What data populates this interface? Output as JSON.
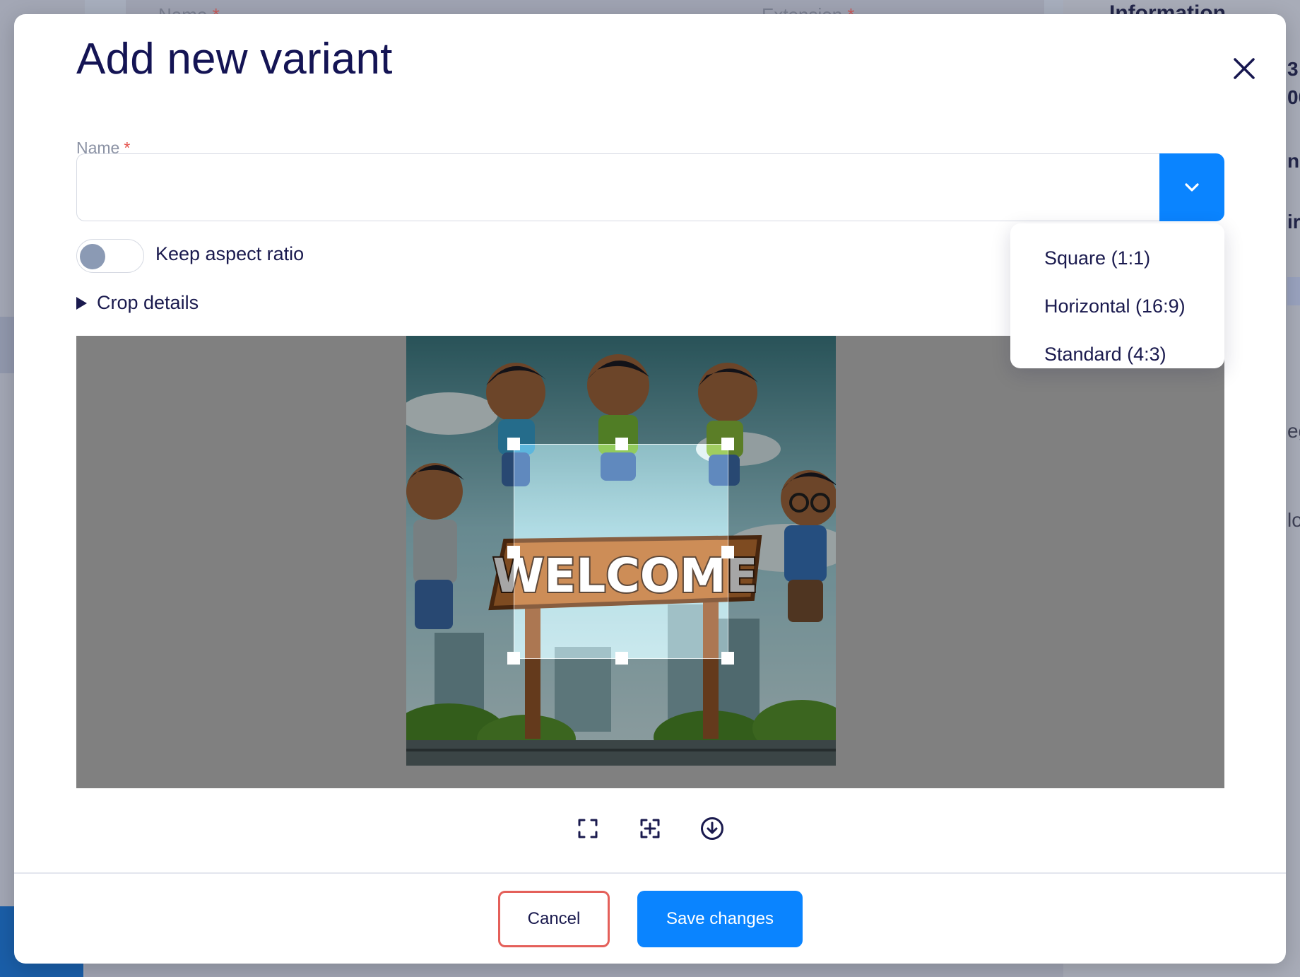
{
  "background": {
    "name_label": "Name",
    "extension_label": "Extension",
    "required_mark": "*",
    "right_title": "Information",
    "right_fragments": [
      "3:",
      "00",
      "n",
      "ir",
      "eg",
      "lo"
    ]
  },
  "modal": {
    "title": "Add new variant",
    "close_icon": "close-icon",
    "name_field": {
      "label": "Name",
      "required_mark": "*",
      "value": "",
      "placeholder": ""
    },
    "dropdown_icon": "chevron-down-icon",
    "dropdown_options": [
      {
        "label": "Square (1:1)"
      },
      {
        "label": "Horizontal (16:9)"
      },
      {
        "label": "Standard (4:3)"
      }
    ],
    "keep_aspect_ratio": {
      "label": "Keep aspect ratio",
      "on": false
    },
    "crop_details_label": "Crop details",
    "image": {
      "sign_text": "WELCOME"
    },
    "tools": [
      "fullscreen-icon",
      "focus-plus-icon",
      "download-circle-icon"
    ],
    "buttons": {
      "cancel": "Cancel",
      "save": "Save changes"
    }
  },
  "colors": {
    "primary": "#0a84ff",
    "cancel_border": "#e4605a",
    "title": "#141454",
    "required": "#e4514b"
  }
}
